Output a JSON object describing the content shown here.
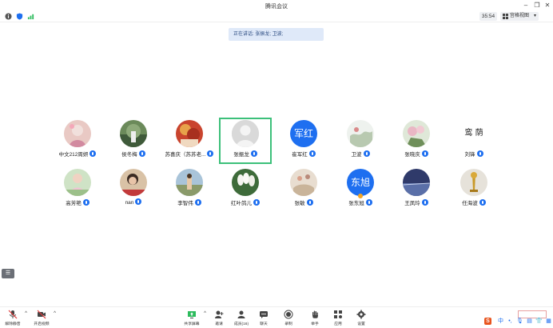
{
  "window": {
    "title": "腾讯会议"
  },
  "status": {
    "timer": "35:54",
    "view_label": "宫格视图"
  },
  "speaking": {
    "text": "正在讲话: 张振龙; 卫波;"
  },
  "participants": [
    {
      "name": "中文212周妍"
    },
    {
      "name": "侯冬梅"
    },
    {
      "name": "苏喜庆（苏苏老..."
    },
    {
      "name": "张振龙"
    },
    {
      "name": "崔军红",
      "avatar_text": "军红"
    },
    {
      "name": "卫波"
    },
    {
      "name": "张晓庆"
    },
    {
      "name": "刘锋",
      "avatar_text": "鸾 荫"
    },
    {
      "name": "高芳艳"
    },
    {
      "name": "nan"
    },
    {
      "name": "李智伟"
    },
    {
      "name": "红叶鸽儿"
    },
    {
      "name": "张敏"
    },
    {
      "name": "张东旭",
      "avatar_text": "东旭"
    },
    {
      "name": "王凤玲"
    },
    {
      "name": "任海波"
    }
  ],
  "toolbar": {
    "unmute": "解除静音",
    "start_video": "开启视频",
    "share_screen": "共享屏幕",
    "invite": "邀请",
    "members": "成员(16)",
    "chat": "聊天",
    "record": "录制",
    "raise_hand": "举手",
    "apps": "应用",
    "settings": "设置"
  },
  "tray": {
    "ime": "中"
  },
  "colors": {
    "accent": "#1e6ff0",
    "active_border": "#3cc07a",
    "highlight_bg": "#dfe9f9"
  }
}
